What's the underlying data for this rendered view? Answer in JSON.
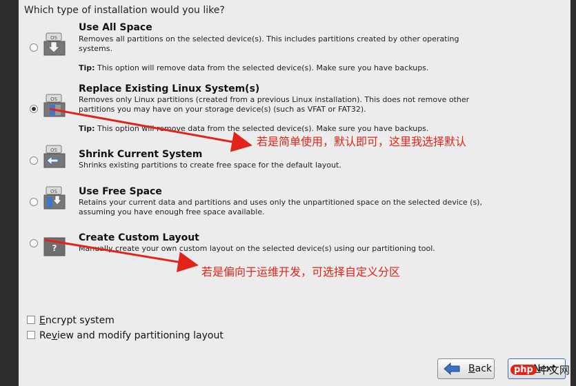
{
  "question": "Which type of installation would you like?",
  "options": [
    {
      "title": "Use All Space",
      "desc": "Removes all partitions on the selected device(s).  This includes partitions created by other operating systems.",
      "tip_label": "Tip:",
      "tip_text": " This option will remove data from the selected device(s).  Make sure you have backups.",
      "selected": false,
      "icon": "harddisk-arrow-down-icon"
    },
    {
      "title": "Replace Existing Linux System(s)",
      "desc": "Removes only Linux partitions (created from a previous Linux installation).  This does not remove other partitions you may have on your storage device(s) (such as VFAT or FAT32).",
      "tip_label": "Tip:",
      "tip_text": " This option will remove data from the selected device(s).  Make sure you have backups.",
      "selected": true,
      "icon": "harddisk-replace-icon"
    },
    {
      "title": "Shrink Current System",
      "desc": "Shrinks existing partitions to create free space for the default layout.",
      "selected": false,
      "icon": "harddisk-shrink-icon"
    },
    {
      "title": "Use Free Space",
      "desc": "Retains your current data and partitions and uses only the unpartitioned space on the selected device (s), assuming you have enough free space available.",
      "selected": false,
      "icon": "harddisk-free-space-icon"
    },
    {
      "title": "Create Custom Layout",
      "desc": "Manually create your own custom layout on the selected device(s) using our partitioning tool.",
      "selected": false,
      "icon": "harddisk-custom-icon"
    }
  ],
  "checkboxes": [
    {
      "accel": "E",
      "rest": "ncrypt system",
      "checked": false
    },
    {
      "prefix": "Re",
      "accel": "v",
      "rest": "iew and modify partitioning layout",
      "checked": false
    }
  ],
  "buttons": {
    "back_accel": "B",
    "back_rest": "ack",
    "next_accel": "N",
    "next_rest": "ext"
  },
  "annotations": {
    "note1": "若是简单使用，默认即可，这里我选择默认",
    "note2": "若是偏向于运维开发，可选择自定义分区"
  },
  "watermark": {
    "php": "php",
    "cn": "中文网"
  },
  "colors": {
    "annotation": "#e2231a",
    "panel": "#ececec",
    "outer": "#2d2d2d"
  }
}
